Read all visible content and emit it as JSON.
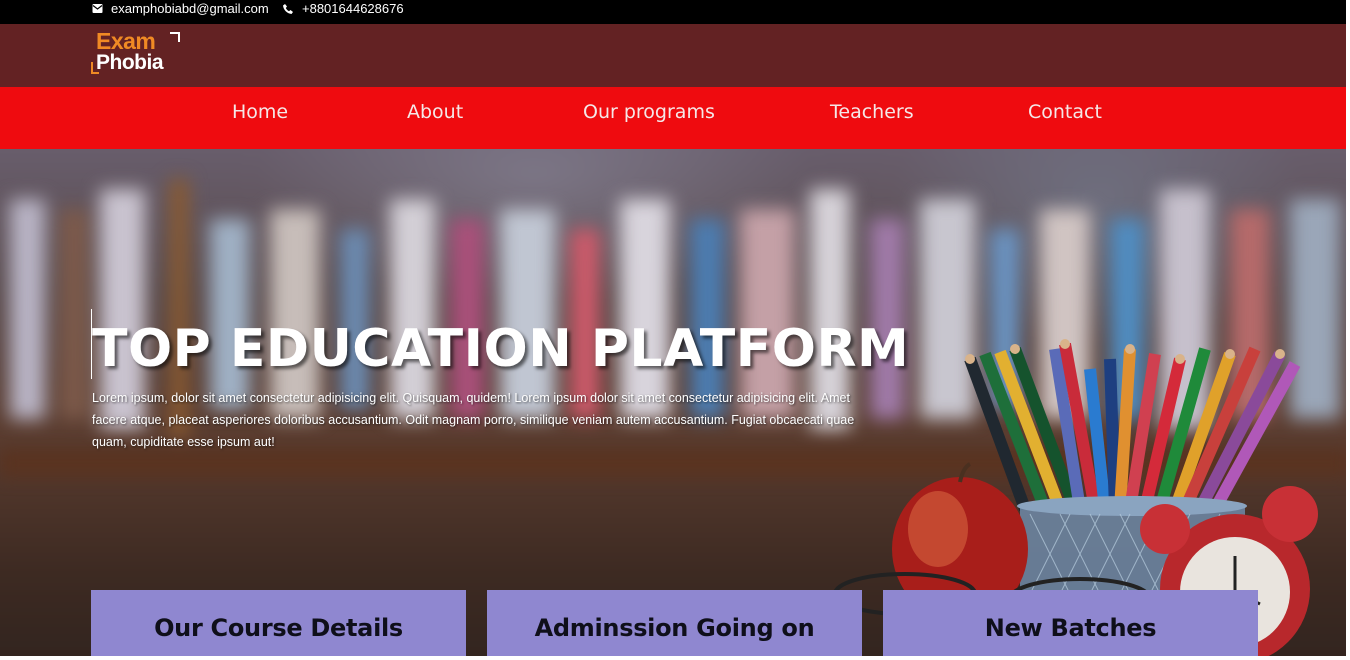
{
  "topbar": {
    "email": "examphobiabd@gmail.com",
    "phone": "+8801644628676",
    "email_icon": "envelope-icon",
    "phone_icon": "phone-icon"
  },
  "brand": {
    "logo_line1": "Exam",
    "logo_line2": "Phobia"
  },
  "nav": {
    "items": [
      {
        "label": "Home"
      },
      {
        "label": "About"
      },
      {
        "label": "Our programs"
      },
      {
        "label": "Teachers"
      },
      {
        "label": "Contact"
      }
    ]
  },
  "hero": {
    "title": "TOP EDUCATION PLATFORM",
    "text": "Lorem ipsum, dolor sit amet consectetur adipisicing elit. Quisquam, quidem! Lorem ipsum dolor sit amet consectetur adipisicing elit. Amet facere atque, placeat asperiores doloribus accusantium. Odit magnam porro, similique veniam autem accusantium. Fugiat obcaecati quae quam, cupiditate esse ipsum aut!"
  },
  "cards": [
    {
      "label": "Our Course Details"
    },
    {
      "label": "Adminssion Going on"
    },
    {
      "label": "New Batches"
    }
  ],
  "colors": {
    "topbar": "#000000",
    "brandbar": "#632223",
    "navbar": "#ef0b0f",
    "card": "#8f87d0",
    "logo_accent": "#f08a24"
  }
}
